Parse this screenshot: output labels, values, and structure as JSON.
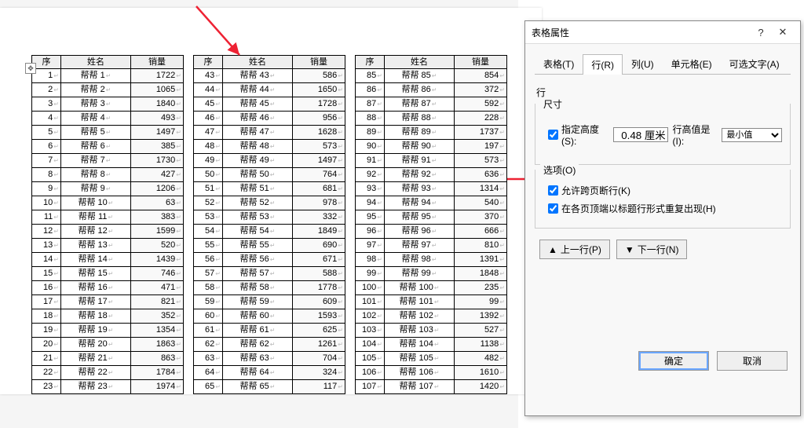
{
  "headers": {
    "idx": "序",
    "name": "姓名",
    "sales": "销量"
  },
  "name_prefix": "帮帮",
  "columns": [
    {
      "start": 1,
      "sales": [
        1722,
        1065,
        1840,
        493,
        1497,
        385,
        1730,
        427,
        1206,
        63,
        383,
        1599,
        520,
        1439,
        746,
        471,
        821,
        352,
        1354,
        1863,
        863,
        1784,
        1974
      ]
    },
    {
      "start": 43,
      "sales": [
        586,
        1650,
        1728,
        956,
        1628,
        573,
        1497,
        764,
        681,
        978,
        332,
        1849,
        690,
        671,
        588,
        1778,
        609,
        1593,
        625,
        1261,
        704,
        324,
        117
      ]
    },
    {
      "start": 85,
      "sales": [
        854,
        372,
        592,
        228,
        1737,
        197,
        573,
        636,
        1314,
        540,
        370,
        666,
        810,
        1391,
        1848,
        235,
        99,
        1392,
        527,
        1138,
        482,
        1610,
        1420
      ]
    }
  ],
  "dialog": {
    "title": "表格属性",
    "help": "?",
    "close": "✕",
    "tabs": [
      "表格(T)",
      "行(R)",
      "列(U)",
      "单元格(E)",
      "可选文字(A)"
    ],
    "active_tab": 1,
    "section_row": "行",
    "size_title": "尺寸",
    "spec_height_label": "指定高度(S):",
    "spec_height_value": "0.48 厘米",
    "row_height_label": "行高值是(I):",
    "row_height_value": "最小值",
    "options_title": "选项(O)",
    "allow_break": "允许跨页断行(K)",
    "repeat_header": "在各页顶端以标题行形式重复出现(H)",
    "prev": "上一行(P)",
    "next": "下一行(N)",
    "ok": "确定",
    "cancel": "取消"
  }
}
